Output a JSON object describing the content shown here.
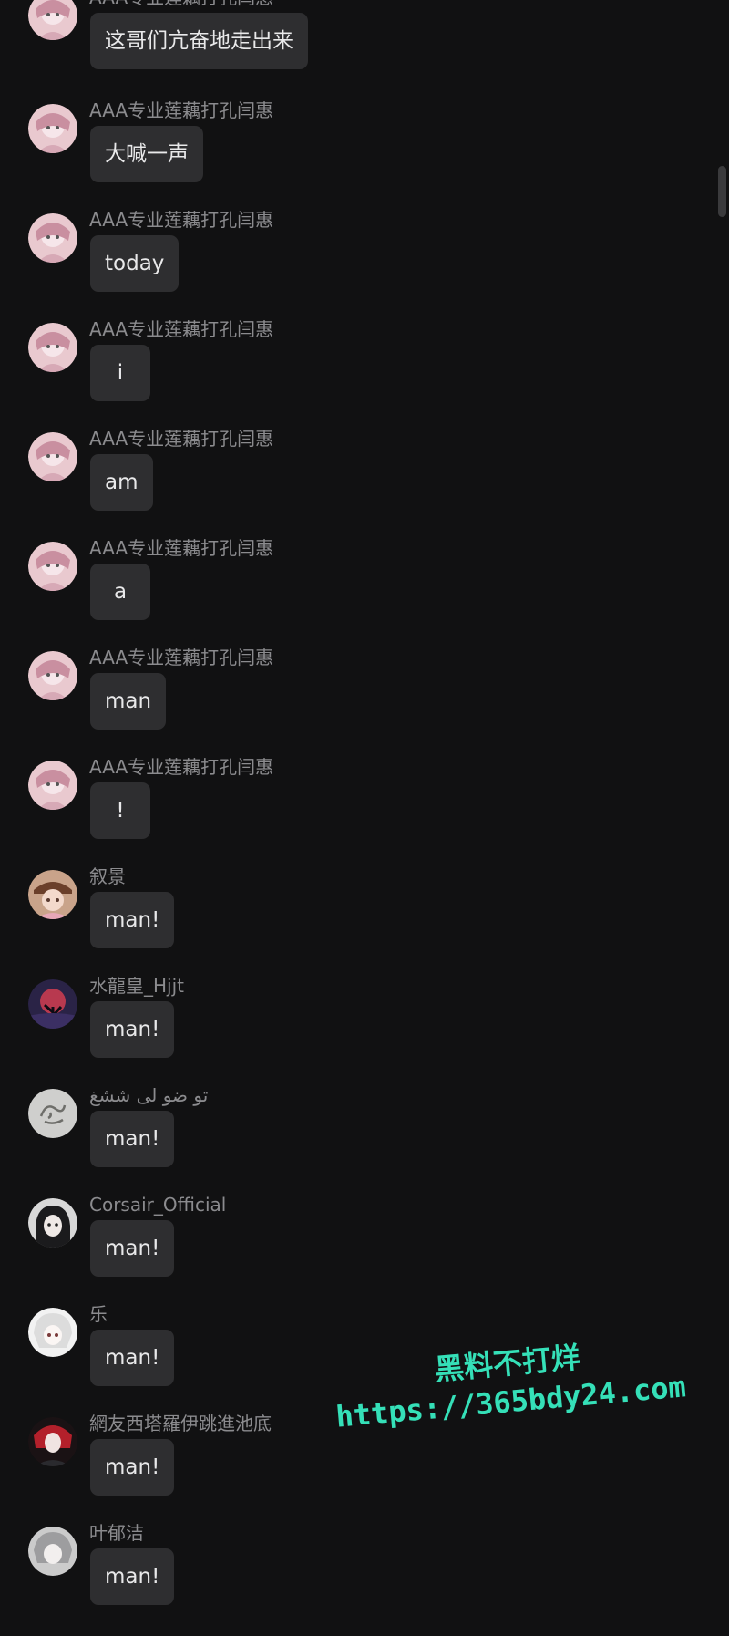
{
  "messages": [
    {
      "username": "AAA专业莲藕打孔闫惠",
      "text": "这哥们亢奋地走出来",
      "avatar": "anime-pink-avatar"
    },
    {
      "username": "AAA专业莲藕打孔闫惠",
      "text": "大喊一声",
      "avatar": "anime-pink-avatar"
    },
    {
      "username": "AAA专业莲藕打孔闫惠",
      "text": "today",
      "avatar": "anime-pink-avatar"
    },
    {
      "username": "AAA专业莲藕打孔闫惠",
      "text": "i",
      "avatar": "anime-pink-avatar"
    },
    {
      "username": "AAA专业莲藕打孔闫惠",
      "text": "am",
      "avatar": "anime-pink-avatar"
    },
    {
      "username": "AAA专业莲藕打孔闫惠",
      "text": "a",
      "avatar": "anime-pink-avatar"
    },
    {
      "username": "AAA专业莲藕打孔闫惠",
      "text": "man",
      "avatar": "anime-pink-avatar"
    },
    {
      "username": "AAA专业莲藕打孔闫惠",
      "text": "!",
      "avatar": "anime-pink-avatar"
    },
    {
      "username": "叙景",
      "text": "man!",
      "avatar": "anime-hat-avatar"
    },
    {
      "username": "水龍皇_Hjjt",
      "text": "man!",
      "avatar": "moon-tree-avatar"
    },
    {
      "username": "تو ضو لی ششغ",
      "text": "man!",
      "avatar": "calligraphy-avatar"
    },
    {
      "username": "Corsair_Official",
      "text": "man!",
      "avatar": "dark-hair-avatar"
    },
    {
      "username": "乐",
      "text": "man!",
      "avatar": "white-hair-avatar"
    },
    {
      "username": "網友西塔羅伊跳進池底",
      "text": "man!",
      "avatar": "red-dark-avatar"
    },
    {
      "username": "叶郁洁",
      "text": "man!",
      "avatar": "grey-anime-avatar"
    }
  ],
  "watermark": {
    "line1": "黑料不打烊",
    "line2": "https://365bdy24.com"
  },
  "colors": {
    "background": "#111112",
    "bubble": "#2e2e30",
    "username": "#8b8b8e",
    "message_text": "#e9e9ea",
    "watermark": "#35e0b8"
  }
}
